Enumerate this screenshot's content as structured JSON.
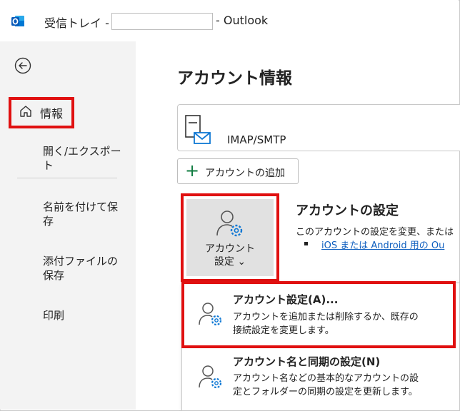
{
  "window": {
    "title_prefix": "受信トレイ -",
    "title_suffix": "- Outlook",
    "app_icon": "outlook-icon"
  },
  "sidebar": {
    "back_icon": "back-arrow-icon",
    "items": [
      {
        "label": "情報",
        "icon": "home-icon",
        "active": true
      },
      {
        "label": "開く/エクスポート"
      },
      {
        "label": "名前を付けて保存"
      },
      {
        "label": "添付ファイルの保存"
      },
      {
        "label": "印刷"
      }
    ]
  },
  "main": {
    "title": "アカウント情報",
    "account": {
      "type": "IMAP/SMTP",
      "icon": "mailbox-icon"
    },
    "add_account_label": "アカウントの追加",
    "account_settings": {
      "button_line1": "アカウント",
      "button_line2": "設定 ⌄",
      "heading": "アカウントの設定",
      "description": "このアカウントの設定を変更、または",
      "link": "iOS または Android 用の Ou"
    },
    "menu": [
      {
        "title": "アカウント設定(A)...",
        "desc_line1": "アカウントを追加または削除するか、既存の",
        "desc_line2": "接続設定を変更します。"
      },
      {
        "title": "アカウント名と同期の設定(N)",
        "desc_line1": "アカウント名などの基本的なアカウントの設",
        "desc_line2": "定とフォルダーの同期の設定を更新します。"
      }
    ]
  },
  "colors": {
    "highlight": "#e01010",
    "link": "#0f5fbf",
    "accent": "#0f78d4",
    "sidebar_bg": "#f3f3f3"
  }
}
